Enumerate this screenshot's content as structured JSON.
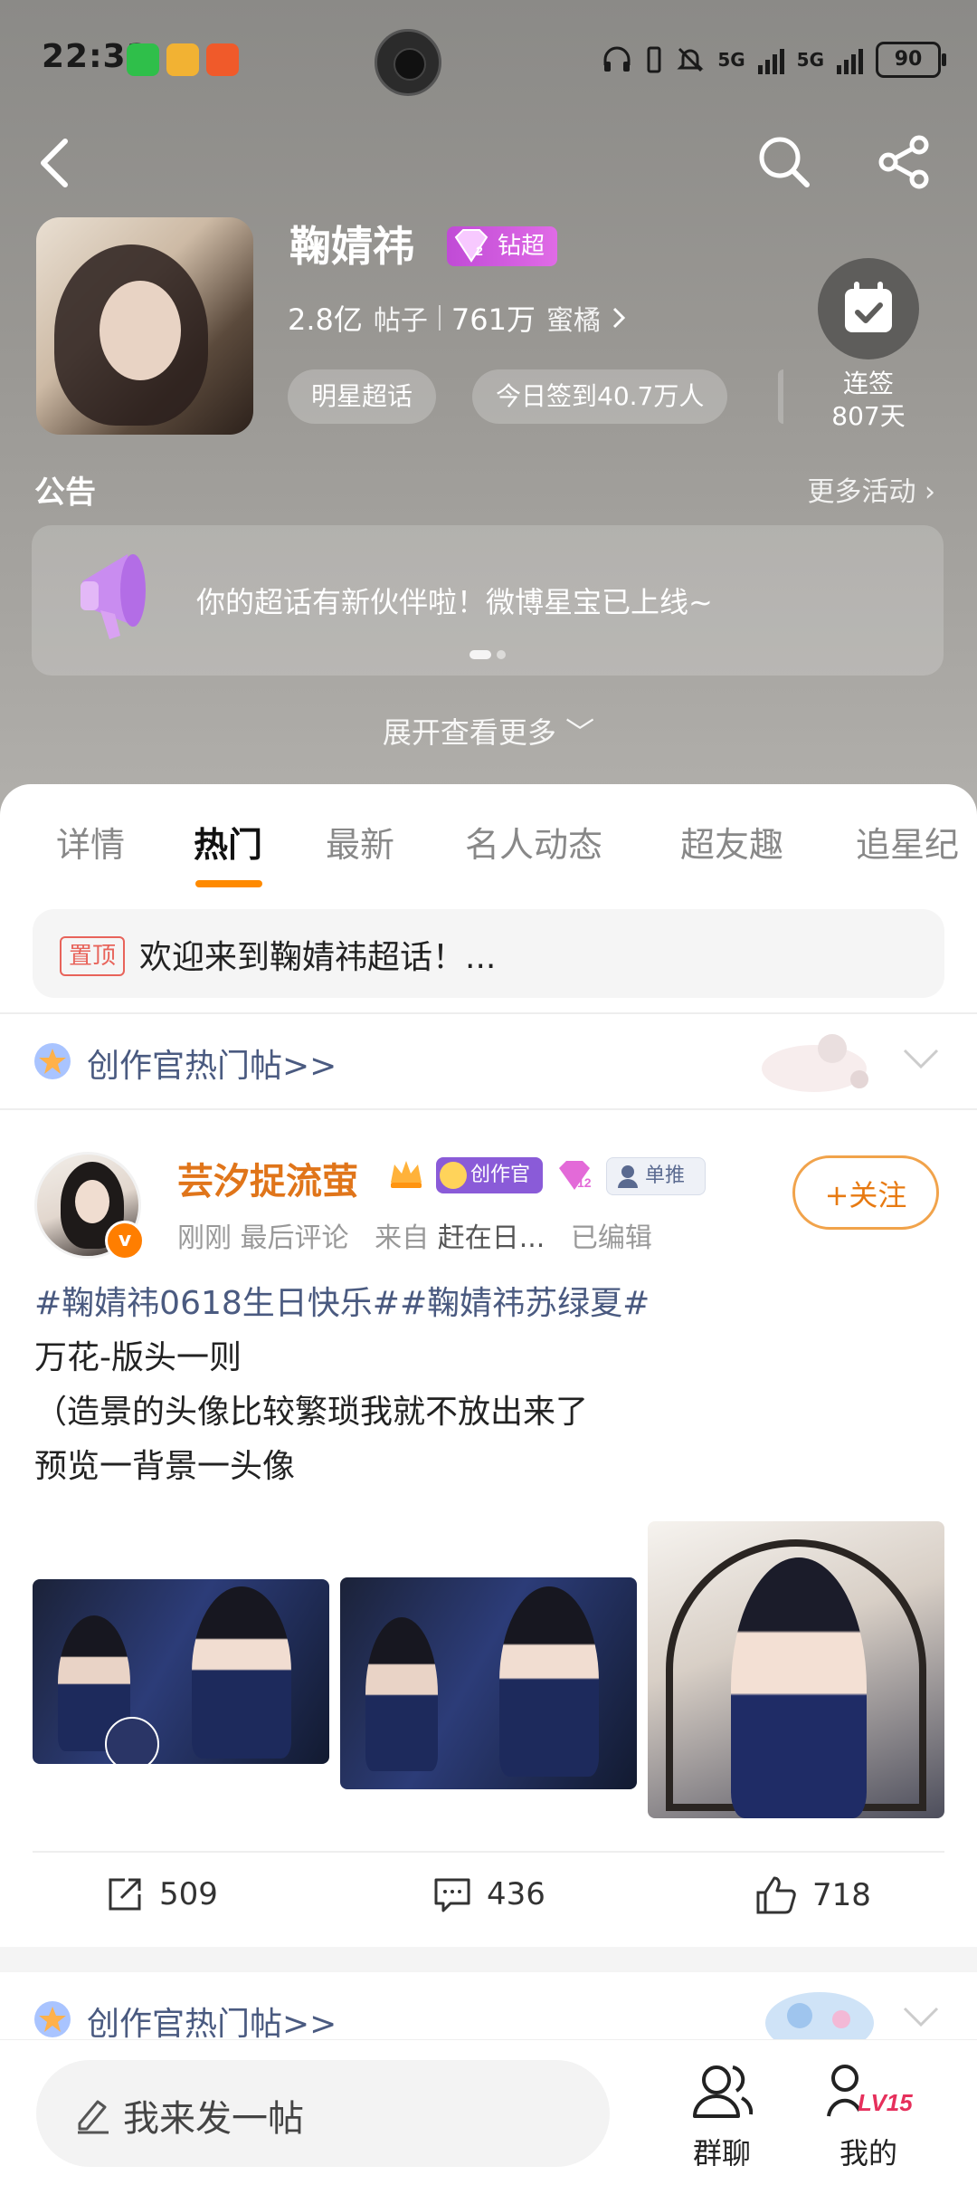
{
  "status_bar": {
    "time": "22:33",
    "network_1": "5G",
    "network_2": "5G",
    "battery": "90"
  },
  "header": {
    "title": "鞠婧祎",
    "level_badge": "钻超",
    "level_num": "2",
    "posts_count": "2.8亿",
    "posts_label": "帖子",
    "fans_count": "761万",
    "fans_label": "蜜橘",
    "tags": [
      "明星超话",
      "今日签到40.7万人"
    ],
    "checkin": {
      "label": "连签",
      "days": "807天"
    }
  },
  "announcement": {
    "title": "公告",
    "more": "更多活动 ›",
    "text": "你的超话有新伙伴啦！微博星宝已上线~",
    "expand": "展开查看更多 ﹀"
  },
  "tabs": [
    "详情",
    "热门",
    "最新",
    "名人动态",
    "超友趣",
    "追星纪"
  ],
  "active_tab": "热门",
  "pinned": {
    "tag": "置顶",
    "text": "欢迎来到鞠婧祎超话！..."
  },
  "hot_section": {
    "label": "创作官热门帖>>"
  },
  "post": {
    "username": "芸汐捉流萤",
    "badge_creator": "创作官",
    "badge_level": "12",
    "badge_single": "单推",
    "meta_time": "刚刚 最后评论",
    "meta_from": "来自",
    "meta_source": "赶在日...",
    "meta_edited": "已编辑",
    "follow_label": "+关注",
    "hashtags": "#鞠婧祎0618生日快乐##鞠婧祎苏绿夏#",
    "lines": [
      "万花-版头一则",
      "（造景的头像比较繁琐我就不放出来了",
      "预览一背景一头像"
    ],
    "shares": "509",
    "comments": "436",
    "likes": "718"
  },
  "hot_section_2": {
    "label": "创作官热门帖>>"
  },
  "bottom_bar": {
    "compose_placeholder": "我来发一帖",
    "group_chat": "群聊",
    "mine": "我的",
    "level": "LV15"
  },
  "colors": {
    "accent": "#ff8a00",
    "username": "#e0751a",
    "topic_blue": "#4a5a80",
    "badge_purple": "#c04bd6"
  }
}
